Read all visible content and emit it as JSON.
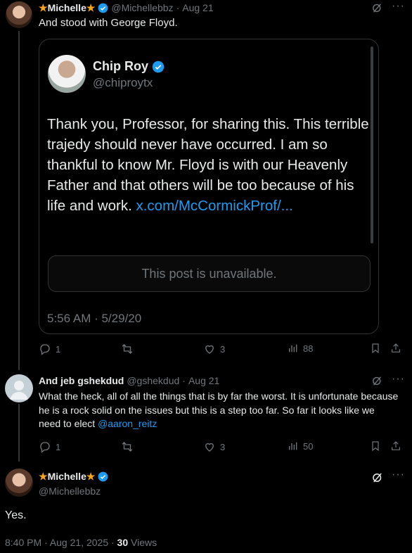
{
  "tweet1": {
    "name": "★Michelle★",
    "handle": "@Michellebbz",
    "time": "Aug 21",
    "sep": "·",
    "text": "And stood with George Floyd.",
    "quote": {
      "name": "Chip Roy",
      "handle": "@chiproytx",
      "text": "Thank you, Professor, for sharing this.   This terrible trajedy should never have occurred.  I am so thankful to know Mr. Floyd is with our Heavenly Father and that others will be too because of his life and work.",
      "link": "x.com/McCormickProf/...",
      "unavailable": "This post is unavailable.",
      "timestamp": "5:56 AM · 5/29/20"
    },
    "stats": {
      "replies": "1",
      "reposts": "",
      "likes": "3",
      "views": "88"
    }
  },
  "tweet2": {
    "name": "And jeb gshekdud",
    "handle": "@gshekdud",
    "time": "Aug 21",
    "sep": "·",
    "text": "What the heck, all of all the things that is by far the worst. It is unfortunate because he is a rock solid on the issues but this is a step too far. So far it looks like we need to elect",
    "mention": "@aaron_reitz",
    "stats": {
      "replies": "1",
      "reposts": "",
      "likes": "3",
      "views": "50"
    }
  },
  "tweet3": {
    "name": "★Michelle★",
    "handle": "@Michellebbz",
    "text": "Yes.",
    "timestamp": "8:40 PM · Aug 21, 2025 · ",
    "views_count": "30",
    "views_label": " Views"
  },
  "colors": {
    "accent": "#1d9bf0",
    "muted": "#71767b",
    "star": "#f4a51c"
  }
}
